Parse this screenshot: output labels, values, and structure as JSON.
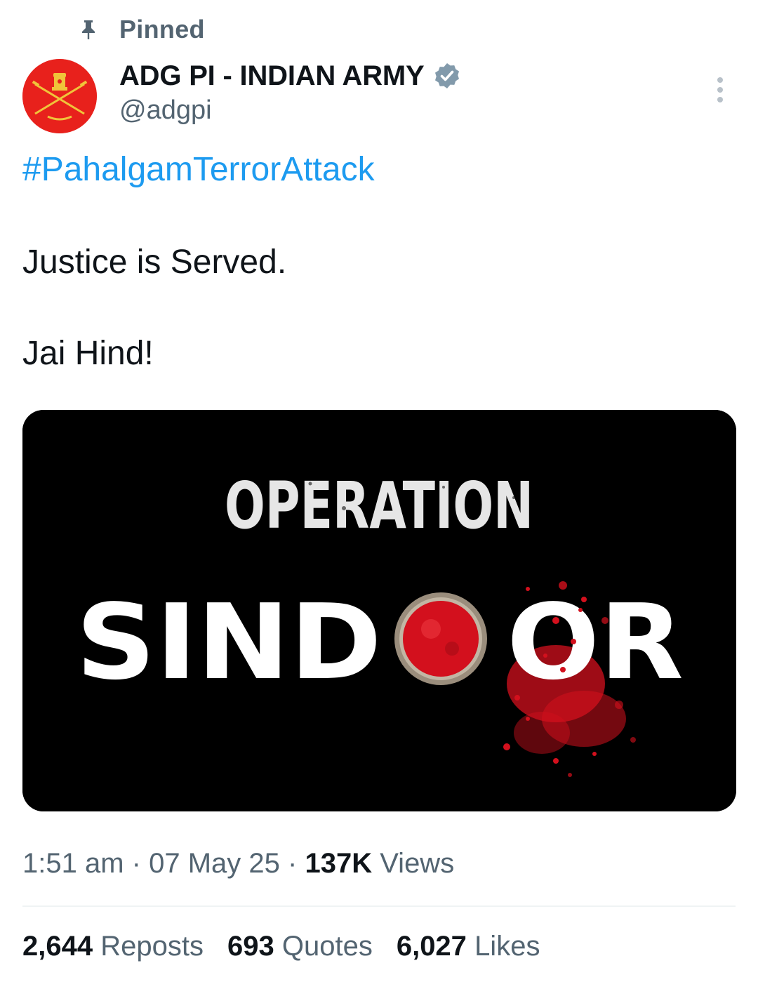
{
  "pinned": {
    "label": "Pinned",
    "icon": "pin-icon"
  },
  "author": {
    "display_name": "ADG PI - INDIAN ARMY",
    "handle": "@adgpi",
    "verified_icon": "verified-badge-icon",
    "avatar_color": "#e8211c"
  },
  "menu": {
    "icon": "more-vertical-icon"
  },
  "post": {
    "hashtag": "#PahalgamTerrorAttack",
    "line1": "Justice is Served.",
    "line2": "Jai Hind!"
  },
  "media": {
    "title_top": "OPERATION",
    "title_bottom_left": "SIND",
    "title_bottom_right": "OR",
    "accent_color": "#d3101d"
  },
  "meta": {
    "time": "1:51 am",
    "sep": "·",
    "date": "07 May 25",
    "views_count": "137K",
    "views_label": "Views"
  },
  "stats": [
    {
      "count": "2,644",
      "label": "Reposts"
    },
    {
      "count": "693",
      "label": "Quotes"
    },
    {
      "count": "6,027",
      "label": "Likes"
    }
  ],
  "colors": {
    "link": "#1d9bf0",
    "secondary_text": "#536471",
    "primary_text": "#0f1419"
  }
}
